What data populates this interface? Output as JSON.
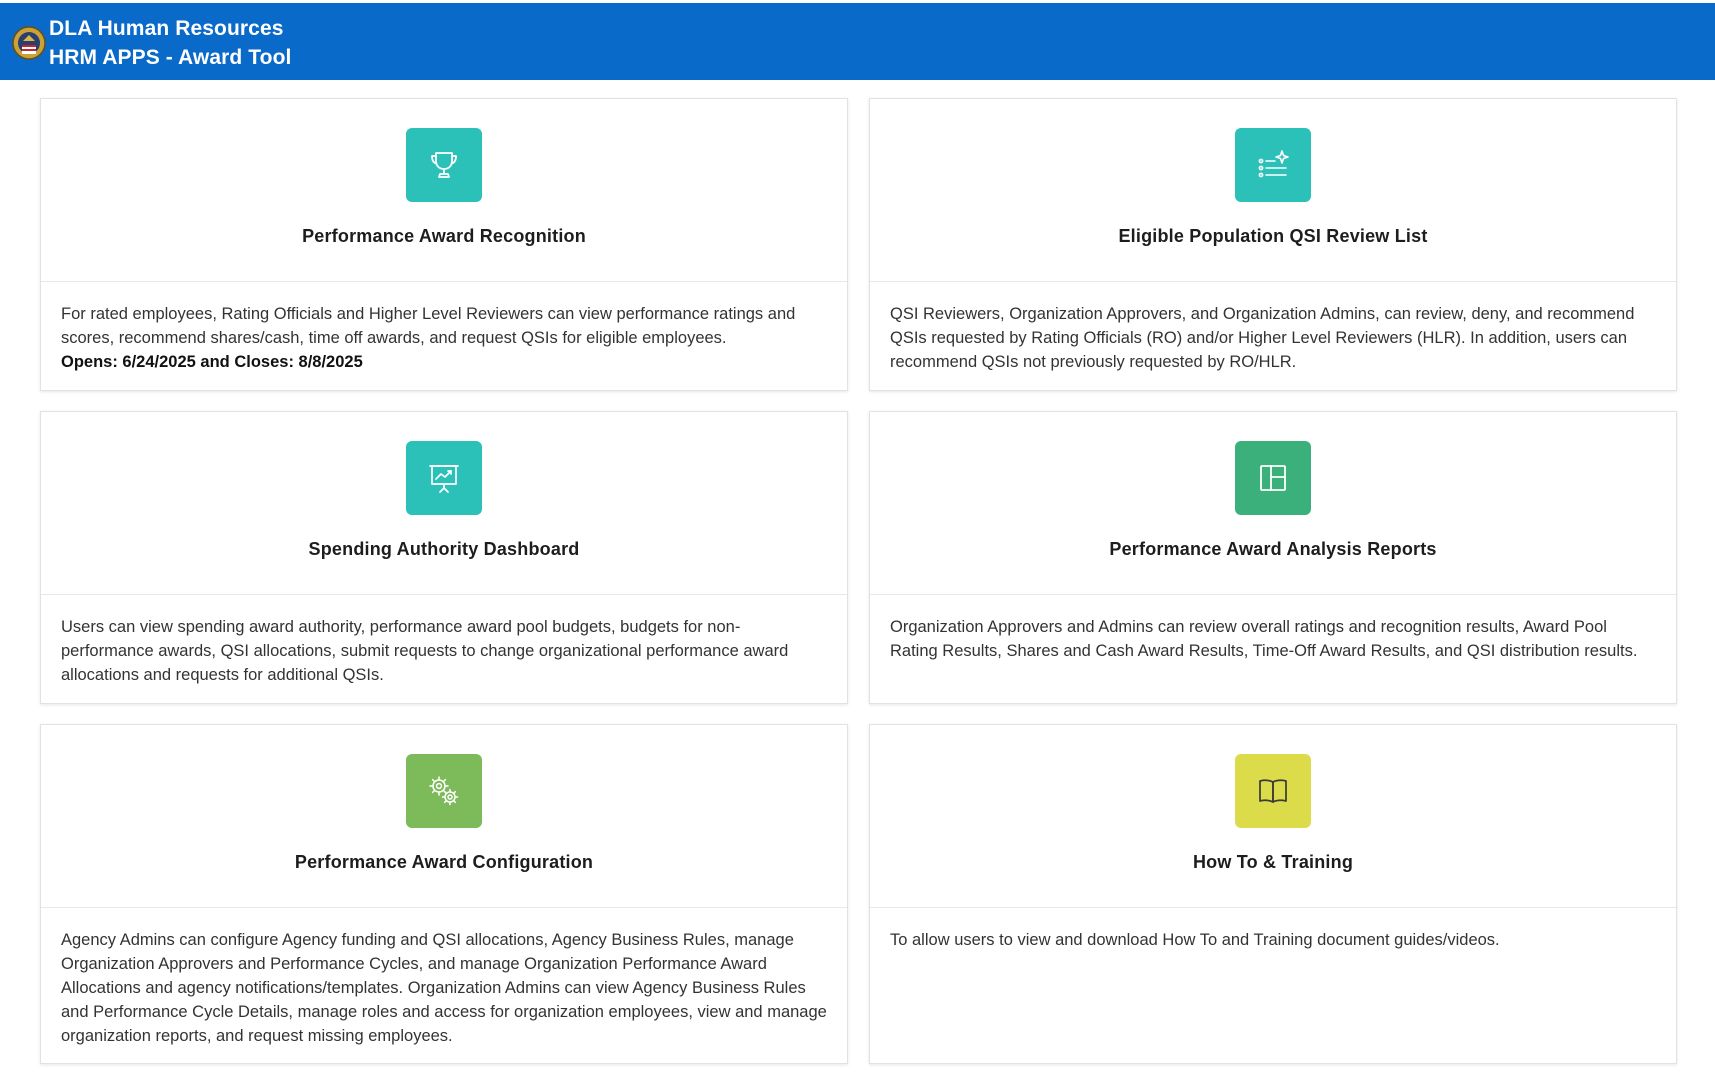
{
  "header": {
    "line1": "DLA Human Resources",
    "line2": "HRM APPS - Award Tool",
    "background": "#0a6ac9"
  },
  "cards": [
    {
      "title": "Performance Award Recognition",
      "icon": "trophy-icon",
      "tile_color": "#2bc0b8",
      "description": "For rated employees, Rating Officials and Higher Level Reviewers can view performance ratings and scores, recommend shares/cash, time off awards, and request QSIs for eligible employees.",
      "note": "Opens: 6/24/2025 and Closes: 8/8/2025"
    },
    {
      "title": "Eligible Population QSI Review List",
      "icon": "list-sparkle-icon",
      "tile_color": "#2bc0b8",
      "description": "QSI Reviewers, Organization Approvers, and Organization Admins, can review, deny, and recommend QSIs requested by Rating Officials (RO) and/or Higher Level Reviewers (HLR). In addition, users can recommend QSIs not previously requested by RO/HLR."
    },
    {
      "title": "Spending Authority Dashboard",
      "icon": "presentation-chart-icon",
      "tile_color": "#2bc0b8",
      "description": "Users can view spending award authority, performance award pool budgets, budgets for non-performance awards, QSI allocations, submit requests to change organizational performance award allocations and requests for additional QSIs."
    },
    {
      "title": "Performance Award Analysis Reports",
      "icon": "layout-panels-icon",
      "tile_color": "#3bb07a",
      "description": "Organization Approvers and Admins can review overall ratings and recognition results, Award Pool Rating Results, Shares and Cash Award Results, Time-Off Award Results, and QSI distribution results."
    },
    {
      "title": "Performance Award Configuration",
      "icon": "gears-icon",
      "tile_color": "#7dbb5a",
      "description": "Agency Admins can configure Agency funding and QSI allocations, Agency Business Rules, manage Organization Approvers and Performance Cycles, and manage Organization Performance Award Allocations and agency notifications/templates. Organization Admins can view Agency Business Rules and Performance Cycle Details, manage roles and access for organization employees, view and manage organization reports, and request missing employees."
    },
    {
      "title": "How To & Training",
      "icon": "open-book-icon",
      "tile_color": "#dcdc4a",
      "description": "To allow users to view and download How To and Training document guides/videos."
    }
  ]
}
